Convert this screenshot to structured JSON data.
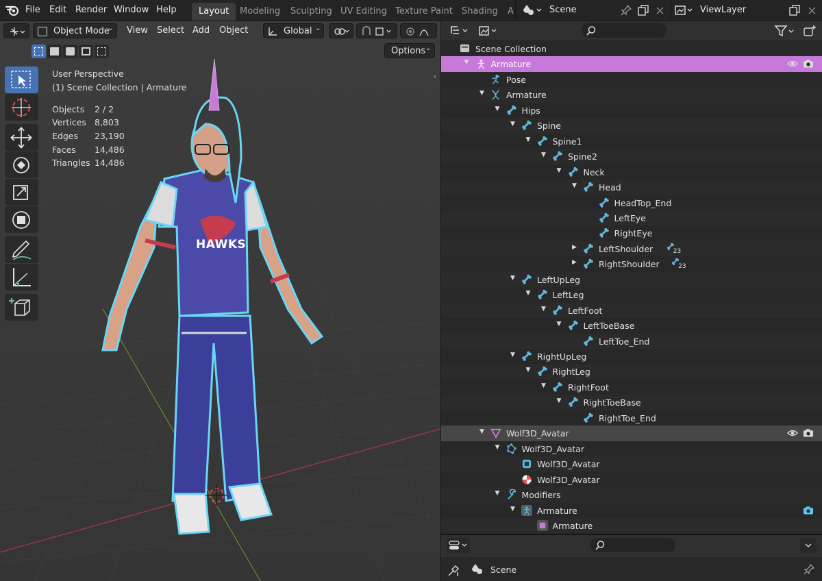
{
  "topbar": {
    "menus": [
      "File",
      "Edit",
      "Render",
      "Window",
      "Help"
    ],
    "workspaces": [
      "Layout",
      "Modeling",
      "Sculpting",
      "UV Editing",
      "Texture Paint",
      "Shading",
      "A"
    ],
    "active_workspace": "Layout",
    "scene_name": "Scene",
    "view_layer": "ViewLayer"
  },
  "viewport": {
    "mode": "Object Mode",
    "menus": [
      "View",
      "Select",
      "Add",
      "Object"
    ],
    "orientation": "Global",
    "options_label": "Options",
    "overlay_title": "User Perspective",
    "overlay_sub": "(1) Scene Collection | Armature",
    "stats": [
      {
        "label": "Objects",
        "value": "2 / 2"
      },
      {
        "label": "Vertices",
        "value": "8,803"
      },
      {
        "label": "Edges",
        "value": "23,190"
      },
      {
        "label": "Faces",
        "value": "14,486"
      },
      {
        "label": "Triangles",
        "value": "14,486"
      }
    ],
    "shirt_text": "HAWKS"
  },
  "outliner": {
    "search_placeholder": "",
    "rows": [
      {
        "label": "Scene Collection",
        "depth": 0,
        "arrow": "",
        "icon": "collection-icon"
      },
      {
        "label": "Armature",
        "depth": 1,
        "arrow": "down",
        "icon": "armature-object-icon",
        "selected": true,
        "vis": true
      },
      {
        "label": "Pose",
        "depth": 2,
        "arrow": "",
        "icon": "pose-icon"
      },
      {
        "label": "Armature",
        "depth": 2,
        "arrow": "down",
        "icon": "armature-data-icon"
      },
      {
        "label": "Hips",
        "depth": 3,
        "arrow": "down",
        "icon": "bone-icon"
      },
      {
        "label": "Spine",
        "depth": 4,
        "arrow": "down",
        "icon": "bone-icon"
      },
      {
        "label": "Spine1",
        "depth": 5,
        "arrow": "down",
        "icon": "bone-icon"
      },
      {
        "label": "Spine2",
        "depth": 6,
        "arrow": "down",
        "icon": "bone-icon"
      },
      {
        "label": "Neck",
        "depth": 7,
        "arrow": "down",
        "icon": "bone-icon"
      },
      {
        "label": "Head",
        "depth": 8,
        "arrow": "down",
        "icon": "bone-icon"
      },
      {
        "label": "HeadTop_End",
        "depth": 9,
        "arrow": "",
        "icon": "bone-icon"
      },
      {
        "label": "LeftEye",
        "depth": 9,
        "arrow": "",
        "icon": "bone-icon"
      },
      {
        "label": "RightEye",
        "depth": 9,
        "arrow": "",
        "icon": "bone-icon"
      },
      {
        "label": "LeftShoulder",
        "depth": 8,
        "arrow": "right",
        "icon": "bone-icon",
        "badge": "23"
      },
      {
        "label": "RightShoulder",
        "depth": 8,
        "arrow": "right",
        "icon": "bone-icon",
        "badge": "23"
      },
      {
        "label": "LeftUpLeg",
        "depth": 4,
        "arrow": "down",
        "icon": "bone-icon"
      },
      {
        "label": "LeftLeg",
        "depth": 5,
        "arrow": "down",
        "icon": "bone-icon"
      },
      {
        "label": "LeftFoot",
        "depth": 6,
        "arrow": "down",
        "icon": "bone-icon"
      },
      {
        "label": "LeftToeBase",
        "depth": 7,
        "arrow": "down",
        "icon": "bone-icon"
      },
      {
        "label": "LeftToe_End",
        "depth": 8,
        "arrow": "",
        "icon": "bone-icon"
      },
      {
        "label": "RightUpLeg",
        "depth": 4,
        "arrow": "down",
        "icon": "bone-icon"
      },
      {
        "label": "RightLeg",
        "depth": 5,
        "arrow": "down",
        "icon": "bone-icon"
      },
      {
        "label": "RightFoot",
        "depth": 6,
        "arrow": "down",
        "icon": "bone-icon"
      },
      {
        "label": "RightToeBase",
        "depth": 7,
        "arrow": "down",
        "icon": "bone-icon"
      },
      {
        "label": "RightToe_End",
        "depth": 8,
        "arrow": "",
        "icon": "bone-icon"
      },
      {
        "label": "Wolf3D_Avatar",
        "depth": 2,
        "arrow": "down",
        "icon": "mesh-object-icon",
        "highlight": true,
        "vis": true
      },
      {
        "label": "Wolf3D_Avatar",
        "depth": 3,
        "arrow": "down",
        "icon": "mesh-data-icon"
      },
      {
        "label": "Wolf3D_Avatar",
        "depth": 4,
        "arrow": "",
        "icon": "material-icon"
      },
      {
        "label": "Wolf3D_Avatar",
        "depth": 4,
        "arrow": "",
        "icon": "material-sphere-icon"
      },
      {
        "label": "Modifiers",
        "depth": 3,
        "arrow": "down",
        "icon": "wrench-icon"
      },
      {
        "label": "Armature",
        "depth": 4,
        "arrow": "down",
        "icon": "armature-modifier-icon",
        "camera": true
      },
      {
        "label": "Armature",
        "depth": 5,
        "arrow": "",
        "icon": "object-data-icon"
      }
    ]
  },
  "properties": {
    "scene_label": "Scene"
  },
  "colors": {
    "accent": "#4772b3",
    "selection": "#c679da",
    "bone": "#5fb8e0",
    "outline": "#5ad0f0"
  }
}
